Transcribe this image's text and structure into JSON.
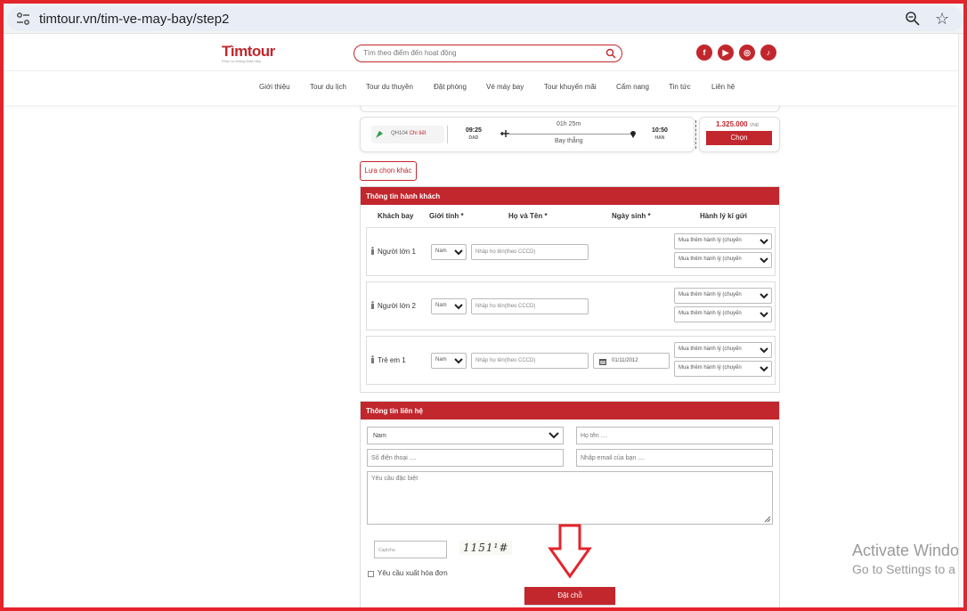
{
  "browser": {
    "url": "timtour.vn/tim-ve-may-bay/step2"
  },
  "header": {
    "logo_text": "Tìmtour",
    "logo_tagline": "Phục vụ không thỏa hiệp",
    "search_placeholder": "Tìm theo điểm đến hoạt động",
    "social": [
      "f",
      "▶",
      "◎",
      "♪"
    ]
  },
  "nav": [
    "Giới thiệu",
    "Tour du lịch",
    "Tour du thuyền",
    "Đặt phòng",
    "Vé máy bay",
    "Tour khuyến mãi",
    "Cẩm nang",
    "Tin tức",
    "Liên hệ"
  ],
  "flight": {
    "flight_no": "QH104",
    "detail_link": "Chi tiết",
    "dep_time": "09:25",
    "dep_code": "DAD",
    "arr_time": "10:50",
    "arr_code": "HAN",
    "duration": "01h 25m",
    "stops": "Bay thẳng",
    "price": "1.325.000",
    "currency": "VNĐ",
    "choose_label": "Chọn",
    "other_label": "Lựa chọn khác"
  },
  "passengers": {
    "title": "Thông tin hành khách",
    "columns": [
      "Khách bay",
      "Giới tính *",
      "Họ và Tên *",
      "Ngày sinh *",
      "Hành lý kí gửi"
    ],
    "rows": [
      {
        "label": "Người lớn 1",
        "gender": "Nam",
        "name_placeholder": "Nhập họ tên(theo CCCD)",
        "dob": "",
        "bag1": "Mua thêm hành lý (chuyến",
        "bag2": "Mua thêm hành lý (chuyến"
      },
      {
        "label": "Người lớn 2",
        "gender": "Nam",
        "name_placeholder": "Nhập họ tên(theo CCCD)",
        "dob": "",
        "bag1": "Mua thêm hành lý (chuyến",
        "bag2": "Mua thêm hành lý (chuyến"
      },
      {
        "label": "Trẻ em 1",
        "gender": "Nam",
        "name_placeholder": "Nhập họ tên(theo CCCD)",
        "dob": "01/11/2012",
        "bag1": "Mua thêm hành lý (chuyến",
        "bag2": "Mua thêm hành lý (chuyến"
      }
    ]
  },
  "contact": {
    "title": "Thông tin liên hệ",
    "gender": "Nam",
    "name_placeholder": "Họ tên ....",
    "phone_placeholder": "Số điện thoại ....",
    "email_placeholder": "Nhập email của bạn ....",
    "note_placeholder": "Yêu cầu đặc biệt",
    "captcha_placeholder": "Captcha",
    "captcha_text": "1151¹#",
    "invoice_label": "Yêu cầu xuất hóa đơn",
    "submit_label": "Đặt chỗ"
  },
  "overlay": {
    "activate_line1": "Activate Windo",
    "activate_line2": "Go to Settings to a"
  },
  "colors": {
    "brand": "#c1272d",
    "annotation": "#e4242b"
  }
}
